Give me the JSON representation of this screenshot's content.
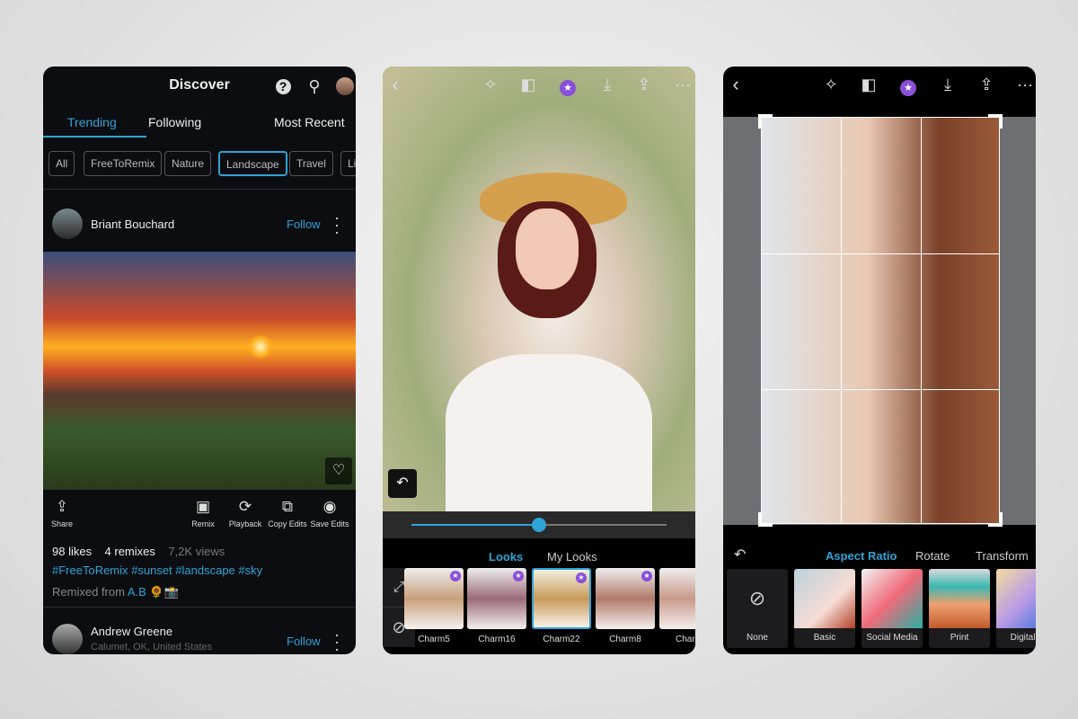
{
  "discover": {
    "title": "Discover",
    "tabs": [
      "Trending",
      "Following",
      "Most Recent"
    ],
    "active_tab": "Trending",
    "chips": [
      "All",
      "FreeToRemix",
      "Nature",
      "Landscape",
      "Travel",
      "Li"
    ],
    "active_chip": "Landscape",
    "post": {
      "author": "Briant Bouchard",
      "follow": "Follow",
      "actions": [
        "Share",
        "Remix",
        "Playback",
        "Copy Edits",
        "Save Edits"
      ],
      "likes": "98 likes",
      "remixes": "4 remixes",
      "views": "7,2K views",
      "tags": "#FreeToRemix #sunset #landscape #sky",
      "remixed_prefix": "Remixed from",
      "remixed_user": "A.B",
      "emoji": "🌻📸"
    },
    "next": {
      "author": "Andrew Greene",
      "location": "Calumet, OK, United States",
      "follow": "Follow"
    }
  },
  "looks": {
    "tabs": [
      "Looks",
      "My Looks"
    ],
    "active_tab": "Looks",
    "items": [
      "Charm5",
      "Charm16",
      "Charm22",
      "Charm8",
      "Charm"
    ],
    "selected": "Charm22",
    "slider_value": 0.5
  },
  "crop": {
    "tabs": [
      "Aspect Ratio",
      "Rotate",
      "Transform"
    ],
    "active_tab": "Aspect Ratio",
    "items": [
      "None",
      "Basic",
      "Social Media",
      "Print",
      "Digital A"
    ]
  },
  "colors": {
    "accent": "#2ea3d6",
    "premium": "#8a4fd8"
  }
}
